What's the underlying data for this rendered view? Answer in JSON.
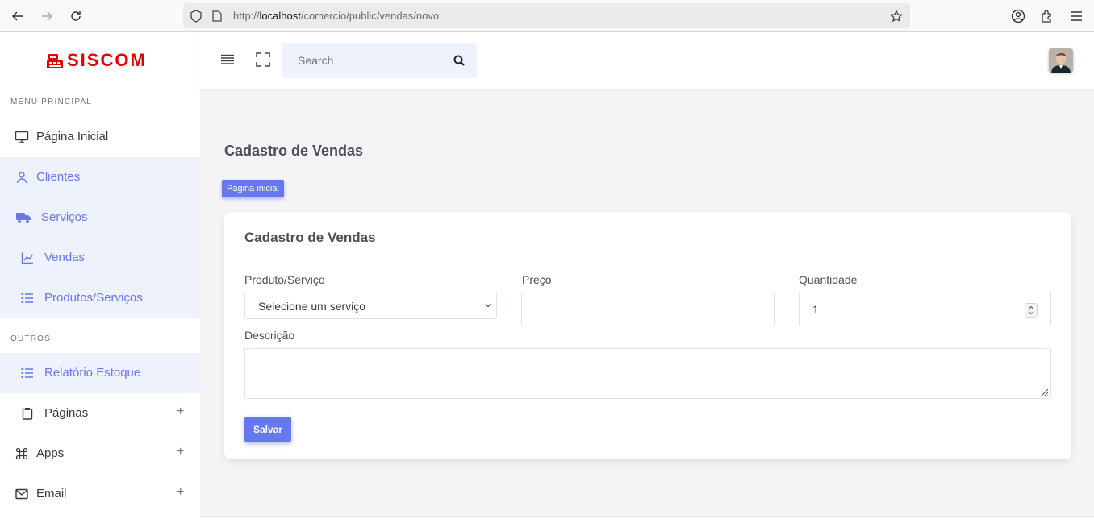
{
  "browser": {
    "url_scheme": "http://",
    "url_host": "localhost",
    "url_path": "/comercio/public/vendas/novo"
  },
  "brand": {
    "name": "SISCOM",
    "color": "#e60000"
  },
  "sidebar": {
    "section_main": "MENU PRINCIPAL",
    "section_others": "OUTROS",
    "items": [
      {
        "label": "Página Inicial",
        "icon": "monitor-icon",
        "active": false
      },
      {
        "label": "Clientes",
        "icon": "user-icon",
        "active": true
      },
      {
        "label": "Serviços",
        "icon": "truck-icon",
        "active": true
      },
      {
        "label": "Vendas",
        "icon": "chart-line-icon",
        "active": true
      },
      {
        "label": "Produtos/Serviços",
        "icon": "list-icon",
        "active": true
      },
      {
        "label": "Relatório Estoque",
        "icon": "list-icon",
        "active": true
      },
      {
        "label": "Páginas",
        "icon": "clipboard-icon",
        "active": false,
        "expandable": "+"
      },
      {
        "label": "Apps",
        "icon": "command-icon",
        "active": false,
        "expandable": "+"
      },
      {
        "label": "Email",
        "icon": "mail-icon",
        "active": false,
        "expandable": "+"
      }
    ]
  },
  "header": {
    "search_placeholder": "Search"
  },
  "main": {
    "page_title": "Cadastro de Vendas",
    "breadcrumb": "Página inicial",
    "form": {
      "title": "Cadastro de Vendas",
      "product_label": "Produto/Serviço",
      "product_value": "Selecione um serviço",
      "price_label": "Preço",
      "price_value": "",
      "quantity_label": "Quantidade",
      "quantity_value": "1",
      "description_label": "Descrição",
      "description_value": "",
      "save_label": "Salvar"
    }
  },
  "colors": {
    "accent": "#6777ef",
    "active_bg": "#eef2fd"
  }
}
